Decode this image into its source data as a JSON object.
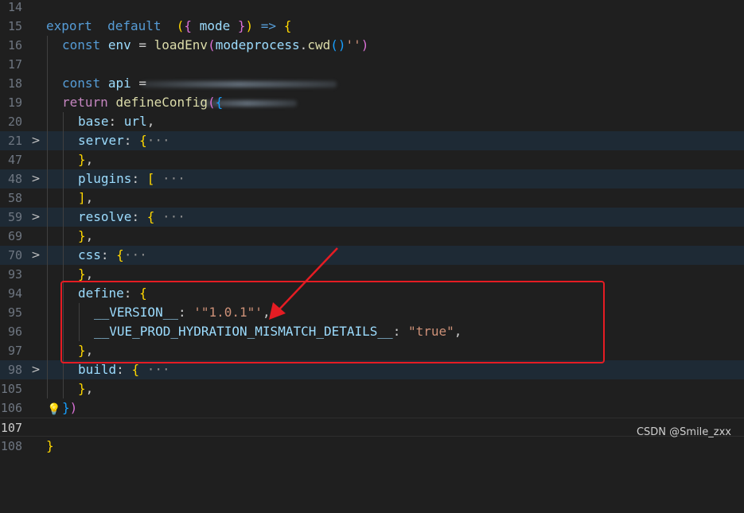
{
  "editor": {
    "lines": [
      {
        "n": "14"
      },
      {
        "n": "15",
        "tokens": [
          [
            "kw",
            "export"
          ],
          [
            "",
            "  "
          ],
          [
            "kw",
            "default"
          ],
          [
            "",
            "  "
          ],
          [
            "p1",
            "("
          ],
          [
            "p2",
            "{"
          ],
          [
            "",
            " "
          ],
          [
            "var",
            "mode"
          ],
          [
            "",
            " "
          ],
          [
            "p2",
            "}"
          ],
          [
            "p1",
            ")"
          ],
          [
            "",
            " "
          ],
          [
            "kw",
            "=>"
          ],
          [
            "",
            " "
          ],
          [
            "p1",
            "{"
          ]
        ]
      },
      {
        "n": "16",
        "tokens": [
          [
            "kw",
            "const"
          ],
          [
            "",
            " "
          ],
          [
            "var",
            "env"
          ],
          [
            "",
            " = "
          ],
          [
            "fn",
            "loadEnv"
          ],
          [
            "p2",
            "("
          ],
          [
            "var",
            "mode"
          ],
          [
            ", "
          ],
          [
            "var",
            "process"
          ],
          [
            "",
            "."
          ],
          [
            "fn",
            "cwd"
          ],
          [
            "p3",
            "()"
          ],
          [
            ", "
          ],
          [
            "str",
            "''"
          ],
          [
            "p2",
            ")"
          ]
        ]
      },
      {
        "n": "17"
      },
      {
        "n": "18",
        "tokens": [
          [
            "kw",
            "const"
          ],
          [
            "",
            " "
          ],
          [
            "var",
            "api"
          ],
          [
            "",
            " ="
          ]
        ]
      },
      {
        "n": "19",
        "tokens": [
          [
            "ctrl",
            "return"
          ],
          [
            "",
            " "
          ],
          [
            "fn",
            "defineConfig"
          ],
          [
            "p2",
            "("
          ],
          [
            "p3",
            "{"
          ]
        ]
      },
      {
        "n": "20",
        "tokens": [
          [
            "var",
            "base"
          ],
          [
            "",
            ": "
          ],
          [
            "var",
            "url"
          ],
          [
            "",
            ","
          ]
        ]
      },
      {
        "n": "21",
        "fold": ">",
        "tokens": [
          [
            "var",
            "server"
          ],
          [
            "",
            ": "
          ],
          [
            "p1",
            "{"
          ],
          [
            "ell",
            "···"
          ]
        ]
      },
      {
        "n": "47",
        "tokens": [
          [
            "p1",
            "}"
          ],
          [
            "",
            ","
          ]
        ]
      },
      {
        "n": "48",
        "fold": ">",
        "tokens": [
          [
            "var",
            "plugins"
          ],
          [
            "",
            ": "
          ],
          [
            "p1",
            "["
          ],
          [
            "",
            " "
          ],
          [
            "ell",
            "···"
          ]
        ]
      },
      {
        "n": "58",
        "tokens": [
          [
            "p1",
            "]"
          ],
          [
            "",
            ","
          ]
        ]
      },
      {
        "n": "59",
        "fold": ">",
        "tokens": [
          [
            "var",
            "resolve"
          ],
          [
            "",
            ": "
          ],
          [
            "p1",
            "{"
          ],
          [
            "",
            " "
          ],
          [
            "ell",
            "···"
          ]
        ]
      },
      {
        "n": "69",
        "tokens": [
          [
            "p1",
            "}"
          ],
          [
            "",
            ","
          ]
        ]
      },
      {
        "n": "70",
        "fold": ">",
        "tokens": [
          [
            "var",
            "css"
          ],
          [
            "",
            ": "
          ],
          [
            "p1",
            "{"
          ],
          [
            "ell",
            "···"
          ]
        ]
      },
      {
        "n": "93",
        "tokens": [
          [
            "p1",
            "}"
          ],
          [
            "",
            ","
          ]
        ]
      },
      {
        "n": "94",
        "tokens": [
          [
            "var",
            "define"
          ],
          [
            "",
            ": "
          ],
          [
            "p1",
            "{"
          ]
        ]
      },
      {
        "n": "95",
        "tokens": [
          [
            "var",
            "__VERSION__"
          ],
          [
            "",
            ": "
          ],
          [
            "str",
            "'\"1.0.1\"'"
          ],
          [
            "",
            ","
          ]
        ]
      },
      {
        "n": "96",
        "tokens": [
          [
            "var",
            "__VUE_PROD_HYDRATION_MISMATCH_DETAILS__"
          ],
          [
            "",
            ": "
          ],
          [
            "str",
            "\"true\""
          ],
          [
            "",
            ","
          ]
        ]
      },
      {
        "n": "97",
        "tokens": [
          [
            "p1",
            "}"
          ],
          [
            "",
            ","
          ]
        ]
      },
      {
        "n": "98",
        "fold": ">",
        "tokens": [
          [
            "var",
            "build"
          ],
          [
            "",
            ": "
          ],
          [
            "p1",
            "{"
          ],
          [
            "",
            " "
          ],
          [
            "ell",
            "···"
          ]
        ]
      },
      {
        "n": "105",
        "tokens": [
          [
            "p1",
            "}"
          ],
          [
            "",
            ","
          ]
        ]
      },
      {
        "n": "106",
        "tokens": [
          [
            "p3",
            "}"
          ],
          [
            "p2",
            ")"
          ]
        ]
      },
      {
        "n": "107"
      },
      {
        "n": "108",
        "tokens": [
          [
            "p1",
            "}"
          ]
        ]
      }
    ]
  },
  "watermark": "CSDN @Smile_zxx",
  "colors": {
    "background": "#1f1f1f",
    "annotation_red": "#e51c23",
    "string": "#ce9178",
    "keyword": "#569cd6",
    "identifier": "#9cdcfe",
    "function": "#dcdcaa"
  },
  "icons": {
    "fold": "chevron-right-icon",
    "bulb": "lightbulb-icon",
    "annotation": "red-arrow-icon"
  }
}
